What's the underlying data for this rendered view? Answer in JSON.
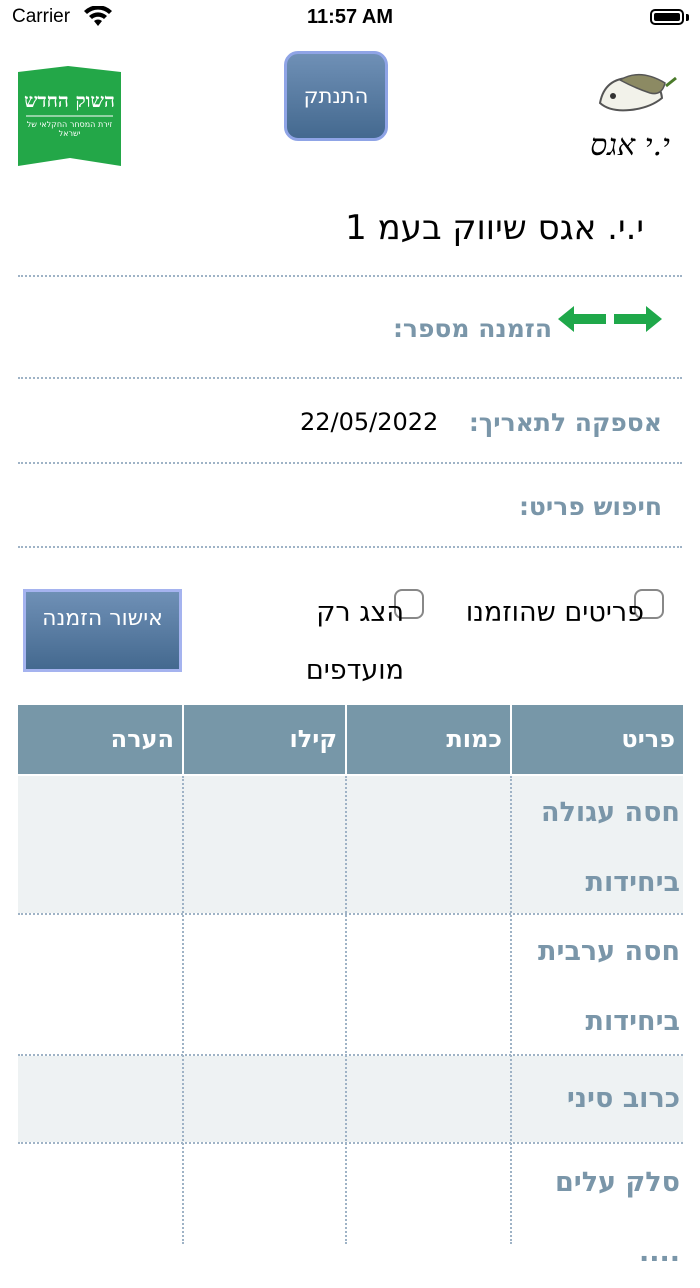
{
  "status_bar": {
    "carrier": "Carrier",
    "time": "11:57 AM"
  },
  "header": {
    "logout_label": "התנתק",
    "market_logo_title": "השוק החדש",
    "market_logo_subtitle": "זירת המסחר החקלאי של ישראל",
    "brand_logo_text": "י.י אגס"
  },
  "supplier": {
    "name": "י.י. אגס שיווק בעמ 1"
  },
  "order": {
    "number_label": "הזמנה מספר:",
    "delivery_label": "אספקה לתאריך:",
    "delivery_date": "22/05/2022",
    "search_label": "חיפוש פריט:"
  },
  "filters": {
    "ordered_items_label": "פריטים שהוזמנו",
    "favorites_only_label": "הצג רק מועדפים",
    "confirm_button_label": "אישור הזמנה"
  },
  "table": {
    "headers": [
      "פריט",
      "כמות",
      "קילו",
      "הערה"
    ],
    "rows": [
      {
        "item": "חסה עגולה ביחידות",
        "quantity": "",
        "kilo": "",
        "note": ""
      },
      {
        "item": "חסה ערבית ביחידות",
        "quantity": "",
        "kilo": "",
        "note": ""
      },
      {
        "item": "כרוב סיני",
        "quantity": "",
        "kilo": "",
        "note": ""
      },
      {
        "item": "סלק עלים ....",
        "quantity": "",
        "kilo": "",
        "note": ""
      }
    ]
  },
  "colors": {
    "accent_green": "#1fa84a",
    "header_blue_gray": "#7797a8",
    "label_blue_gray": "#7a96a9",
    "button_blue": "#5679a0"
  }
}
